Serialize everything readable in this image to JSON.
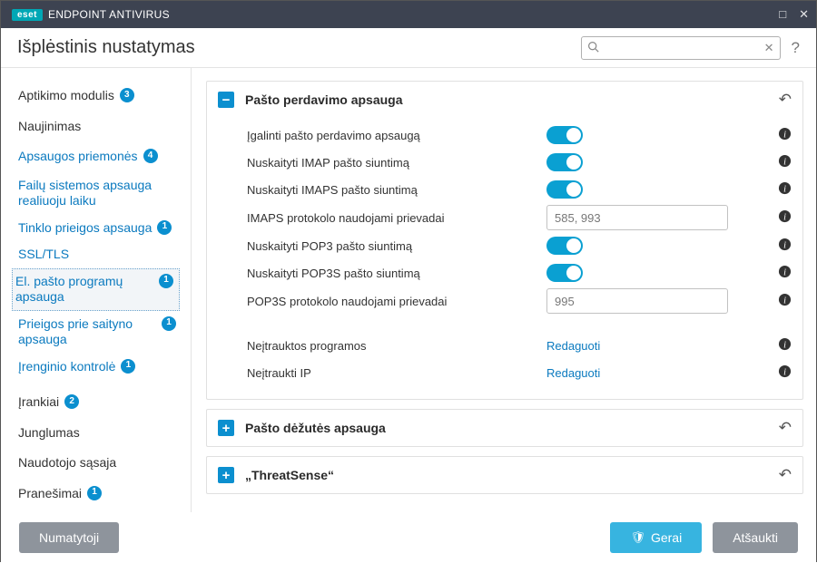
{
  "titlebar": {
    "brand": "eset",
    "product": "ENDPOINT ANTIVIRUS"
  },
  "header": {
    "title": "Išplėstinis nustatymas",
    "search_placeholder": ""
  },
  "sidebar": {
    "aptikimo": {
      "label": "Aptikimo modulis",
      "count": "3"
    },
    "naujinimas": {
      "label": "Naujinimas"
    },
    "apsaugos": {
      "label": "Apsaugos priemonės",
      "count": "4"
    },
    "failu": {
      "label": "Failų sistemos apsauga realiuoju laiku"
    },
    "tinklo": {
      "label": "Tinklo prieigos apsauga",
      "count": "1"
    },
    "ssl": {
      "label": "SSL/TLS"
    },
    "elpasto": {
      "label": "El. pašto programų apsauga",
      "count": "1"
    },
    "prieigos": {
      "label": "Prieigos prie saityno apsauga",
      "count": "1"
    },
    "irenginio": {
      "label": "Įrenginio kontrolė",
      "count": "1"
    },
    "irankiai": {
      "label": "Įrankiai",
      "count": "2"
    },
    "junglumas": {
      "label": "Junglumas"
    },
    "sasaja": {
      "label": "Naudotojo sąsaja"
    },
    "pranesimai": {
      "label": "Pranešimai",
      "count": "1"
    }
  },
  "panels": {
    "transport": {
      "title": "Pašto perdavimo apsauga",
      "rows": {
        "enable": {
          "label": "Įgalinti pašto perdavimo apsaugą"
        },
        "imap": {
          "label": "Nuskaityti IMAP pašto siuntimą"
        },
        "imaps": {
          "label": "Nuskaityti IMAPS pašto siuntimą"
        },
        "imapsPorts": {
          "label": "IMAPS protokolo naudojami prievadai",
          "value": "585, 993"
        },
        "pop3": {
          "label": "Nuskaityti POP3 pašto siuntimą"
        },
        "pop3s": {
          "label": "Nuskaityti POP3S pašto siuntimą"
        },
        "pop3sPorts": {
          "label": "POP3S protokolo naudojami prievadai",
          "value": "995"
        },
        "exclApps": {
          "label": "Neįtrauktos programos",
          "action": "Redaguoti"
        },
        "exclIps": {
          "label": "Neįtraukti IP",
          "action": "Redaguoti"
        }
      }
    },
    "mailbox": {
      "title": "Pašto dėžutės apsauga"
    },
    "threatsense": {
      "title": "„ThreatSense“"
    }
  },
  "footer": {
    "default": "Numatytoji",
    "ok": "Gerai",
    "cancel": "Atšaukti"
  }
}
